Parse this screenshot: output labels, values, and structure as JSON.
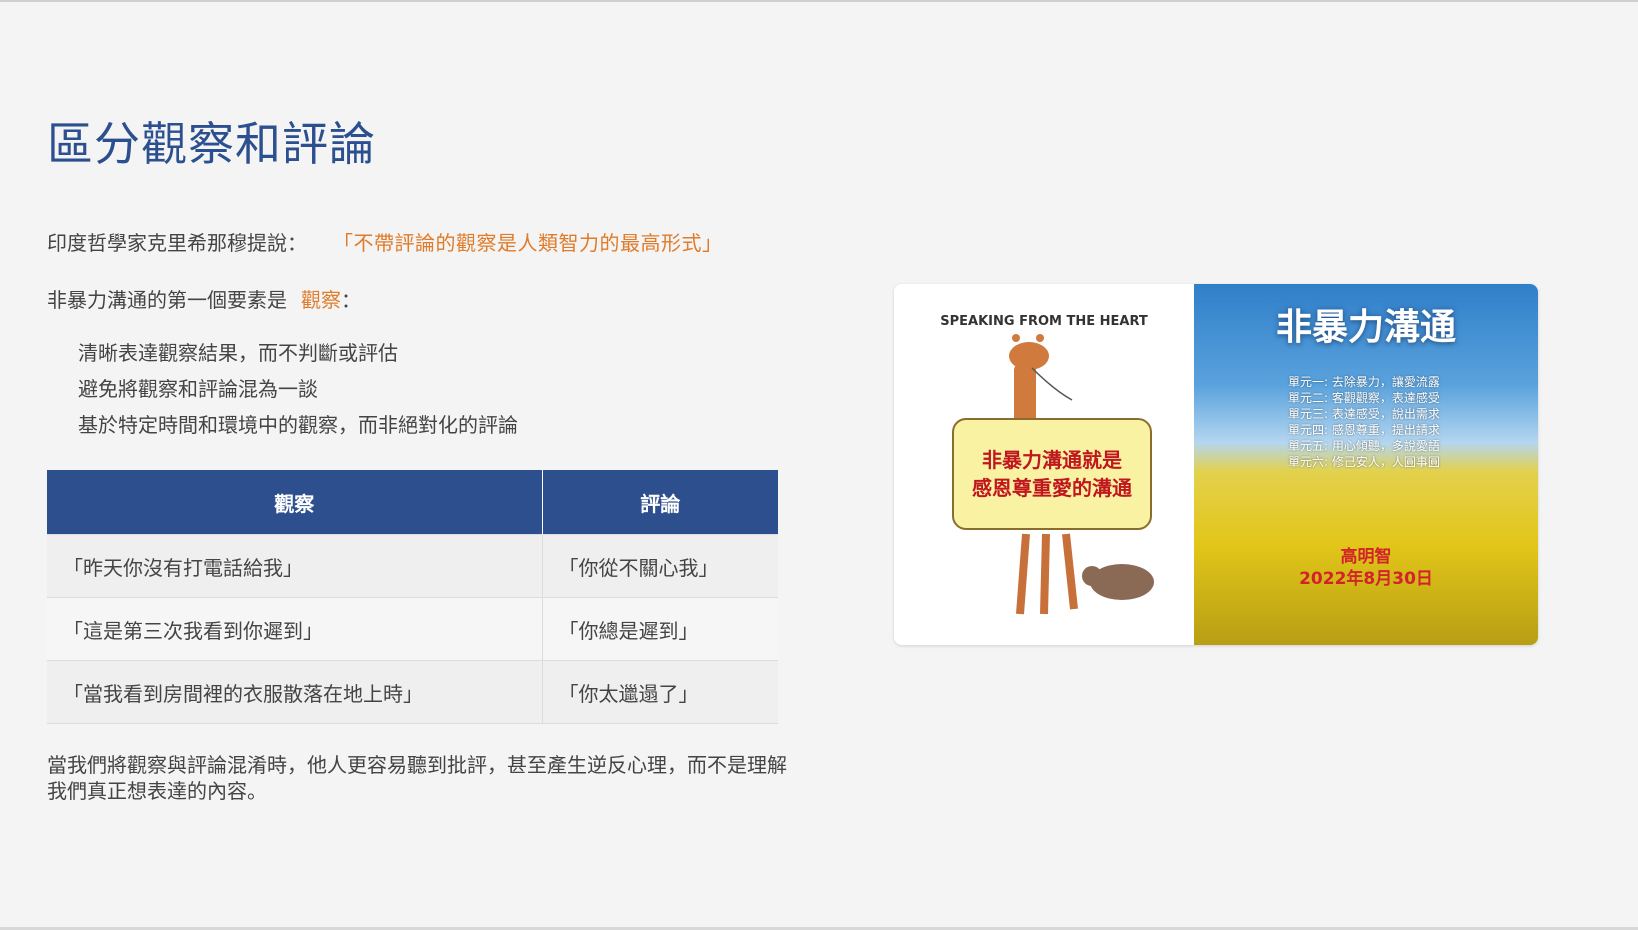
{
  "slide": {
    "title": "區分觀察和評論",
    "quote_intro": "印度哲學家克里希那穆提說：",
    "quote": "「不帶評論的觀察是人類智力的最高形式」",
    "element_intro": "非暴力溝通的第一個要素是",
    "element_highlight": "觀察",
    "element_suffix": "：",
    "bullets": [
      "清晰表達觀察結果，而不判斷或評估",
      "避免將觀察和評論混為一談",
      "基於特定時間和環境中的觀察，而非絕對化的評論"
    ],
    "table": {
      "headers": [
        "觀察",
        "評論"
      ],
      "rows": [
        [
          "「昨天你沒有打電話給我」",
          "「你從不關心我」"
        ],
        [
          "「這是第三次我看到你遲到」",
          "「你總是遲到」"
        ],
        [
          "「當我看到房間裡的衣服散落在地上時」",
          "「你太邋遢了」"
        ]
      ]
    },
    "summary": "當我們將觀察與評論混淆時，他人更容易聽到批評，甚至產生逆反心理，而不是理解我們真正想表達的內容。"
  },
  "book_cover": {
    "left_caption": "SPEAKING FROM THE HEART",
    "sign_line1": "非暴力溝通就是",
    "sign_line2": "感恩尊重愛的溝通",
    "title": "非暴力溝通",
    "units": [
      "單元一: 去除暴力，讓愛流露",
      "單元二: 客觀觀察，表達感受",
      "單元三: 表達感受，說出需求",
      "單元四: 感恩尊重，提出請求",
      "單元五: 用心傾聽，多說愛語",
      "單元六: 修己安人，人圓事圓"
    ],
    "author": "高明智",
    "date": "2022年8月30日"
  },
  "colors": {
    "title": "#2c4f8f",
    "accent": "#e07b2a",
    "table_header": "#2d4f8e",
    "background": "#f4f4f4",
    "sign_text": "#c0171f"
  }
}
